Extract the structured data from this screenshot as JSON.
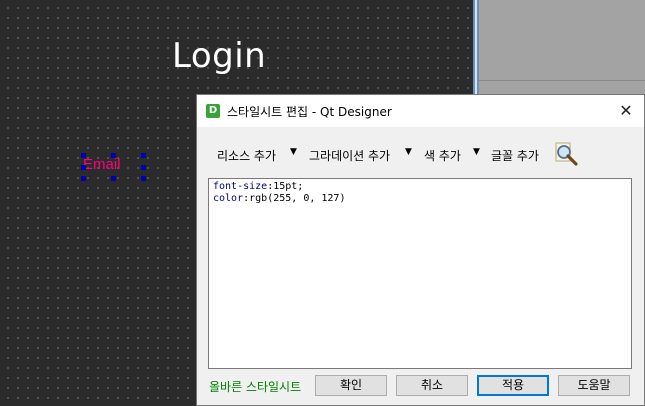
{
  "canvas": {
    "login_title": "Login",
    "email_label": "Email",
    "email_color": "#ff007f"
  },
  "dialog": {
    "title": "스타일시트 편집 - Qt Designer",
    "app_icon_letter": "D",
    "close_glyph": "✕",
    "toolbar": {
      "add_resource": "리소스 추가",
      "add_gradient": "그라데이션 추가",
      "add_color": "색 추가",
      "add_font": "글꼴 추가",
      "dropdown_glyph": "▼",
      "magnifier_icon": "magnifier-icon"
    },
    "editor": {
      "line1_prop": "font-size",
      "line1_val": ":15pt;",
      "line2_prop": "color",
      "line2_val": ":rgb(255, 0, 127)"
    },
    "status": "올바른 스타일시트",
    "buttons": {
      "ok": "확인",
      "cancel": "취소",
      "apply": "적용",
      "help": "도움말"
    }
  }
}
